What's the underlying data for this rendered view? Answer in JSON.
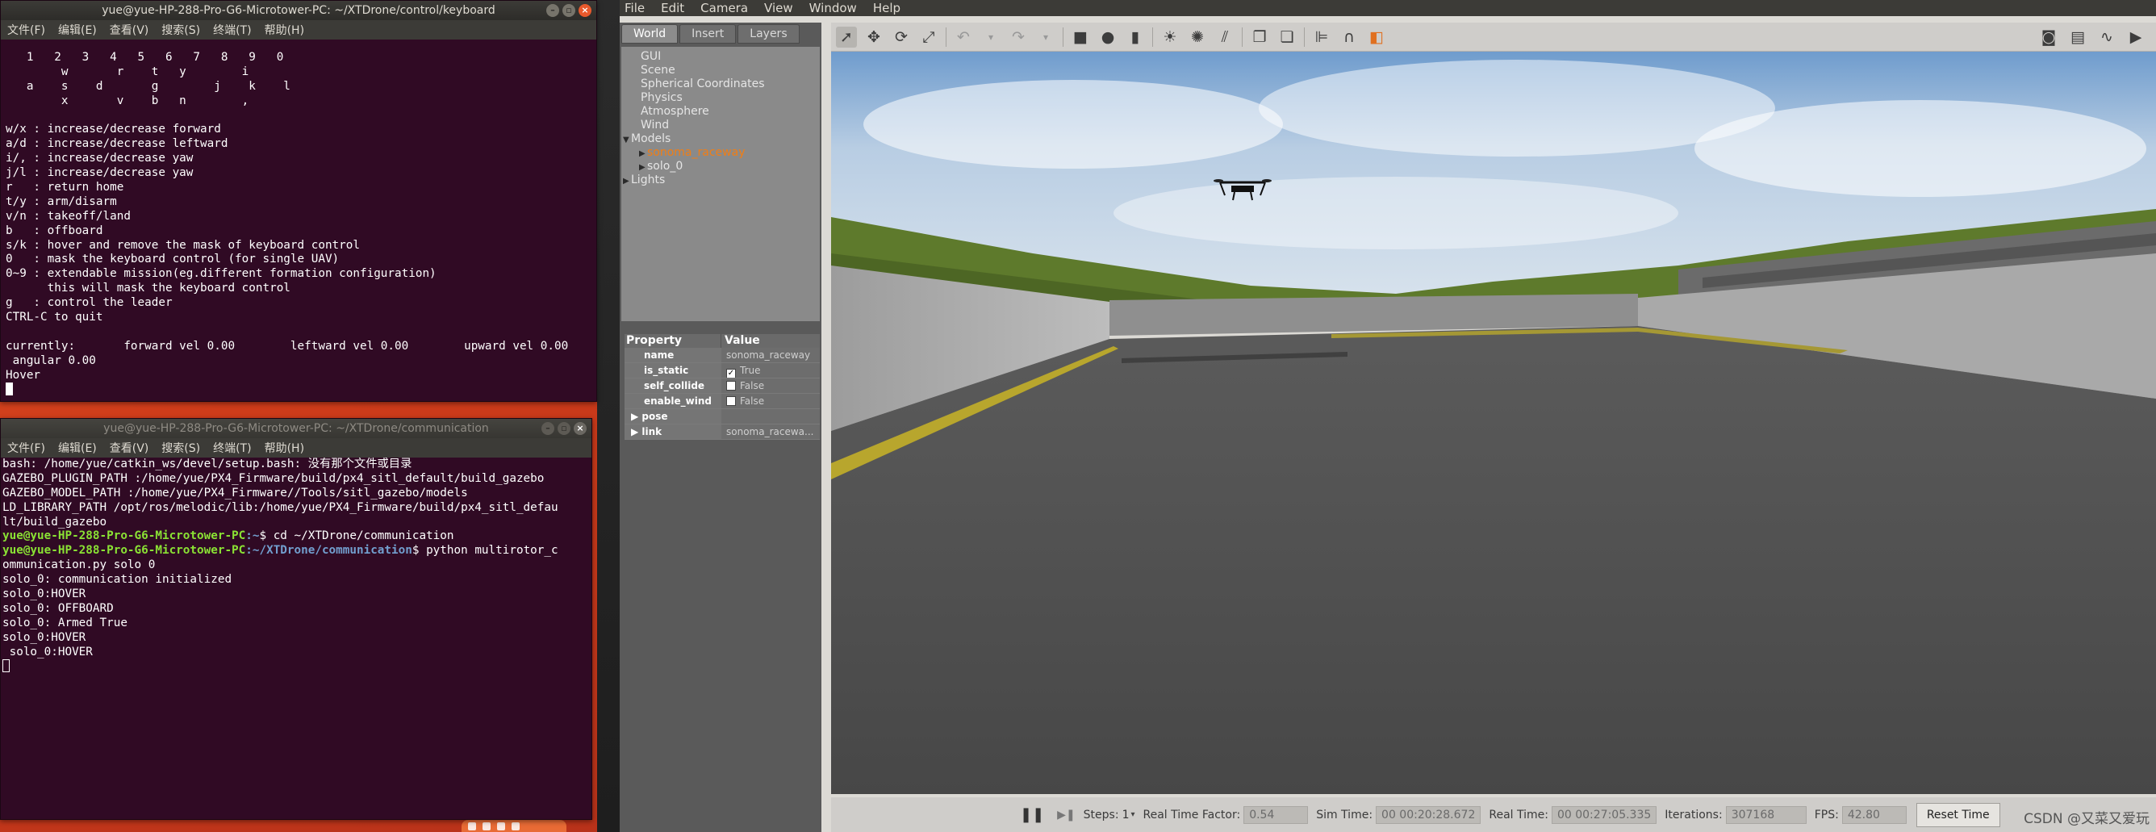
{
  "desktop": {
    "tray_count": 4
  },
  "keyboard_terminal": {
    "title": "yue@yue-HP-288-Pro-G6-Microtower-PC: ~/XTDrone/control/keyboard",
    "menu": [
      "文件(F)",
      "编辑(E)",
      "查看(V)",
      "搜索(S)",
      "终端(T)",
      "帮助(H)"
    ],
    "lines": [
      "   1   2   3   4   5   6   7   8   9   0",
      "        w       r    t   y        i",
      "   a    s    d       g        j    k    l",
      "        x       v    b   n        ,",
      "",
      "w/x : increase/decrease forward",
      "a/d : increase/decrease leftward",
      "i/, : increase/decrease yaw",
      "j/l : increase/decrease yaw",
      "r   : return home",
      "t/y : arm/disarm",
      "v/n : takeoff/land",
      "b   : offboard",
      "s/k : hover and remove the mask of keyboard control",
      "0   : mask the keyboard control (for single UAV)",
      "0~9 : extendable mission(eg.different formation configuration)",
      "      this will mask the keyboard control",
      "g   : control the leader",
      "CTRL-C to quit",
      "",
      "currently:       forward vel 0.00        leftward vel 0.00        upward vel 0.00",
      " angular 0.00",
      "Hover"
    ]
  },
  "comm_terminal": {
    "title": "yue@yue-HP-288-Pro-G6-Microtower-PC: ~/XTDrone/communication",
    "menu": [
      "文件(F)",
      "编辑(E)",
      "查看(V)",
      "搜索(S)",
      "终端(T)",
      "帮助(H)"
    ],
    "lines_before": [
      "bash: /home/yue/catkin_ws/devel/setup.bash: 没有那个文件或目录",
      "GAZEBO_PLUGIN_PATH :/home/yue/PX4_Firmware/build/px4_sitl_default/build_gazebo",
      "GAZEBO_MODEL_PATH :/home/yue/PX4_Firmware//Tools/sitl_gazebo/models",
      "LD_LIBRARY_PATH /opt/ros/melodic/lib:/home/yue/PX4_Firmware/build/px4_sitl_defau",
      "lt/build_gazebo"
    ],
    "prompt1_user": "yue@yue-HP-288-Pro-G6-Microtower-PC",
    "prompt1_path": ":~",
    "prompt1_cmd": "$ cd ~/XTDrone/communication",
    "prompt2_user": "yue@yue-HP-288-Pro-G6-Microtower-PC",
    "prompt2_path": ":~/XTDrone/communication",
    "prompt2_cmd": "$ python multirotor_c",
    "lines_after": [
      "ommunication.py solo 0",
      "solo_0: communication initialized",
      "solo_0:HOVER",
      "solo_0: OFFBOARD",
      "solo_0: Armed True",
      "solo_0:HOVER",
      " solo_0:HOVER"
    ]
  },
  "gazebo": {
    "menu": [
      "File",
      "Edit",
      "Camera",
      "View",
      "Window",
      "Help"
    ],
    "tabs": [
      "World",
      "Insert",
      "Layers"
    ],
    "tree": [
      "GUI",
      "Scene",
      "Spherical Coordinates",
      "Physics",
      "Atmosphere",
      "Wind",
      "Models",
      "sonoma_raceway",
      "solo_0",
      "Lights"
    ],
    "props_header": {
      "property": "Property",
      "value": "Value"
    },
    "props": [
      {
        "key": "name",
        "value": "sonoma_raceway"
      },
      {
        "key": "is_static",
        "value": "True"
      },
      {
        "key": "self_collide",
        "value": "False"
      },
      {
        "key": "enable_wind",
        "value": "False"
      },
      {
        "key": "pose",
        "value": ""
      },
      {
        "key": "link",
        "value": "sonoma_racewa..."
      }
    ],
    "bottom": {
      "steps_label": "Steps:",
      "steps_value": "1",
      "rtf_label": "Real Time Factor:",
      "rtf_value": "0.54",
      "sim_label": "Sim Time:",
      "sim_value": "00 00:20:28.672",
      "real_label": "Real Time:",
      "real_value": "00 00:27:05.335",
      "iter_label": "Iterations:",
      "iter_value": "307168",
      "fps_label": "FPS:",
      "fps_value": "42.80",
      "reset_label": "Reset Time"
    },
    "watermark": "CSDN @又菜又爱玩"
  }
}
